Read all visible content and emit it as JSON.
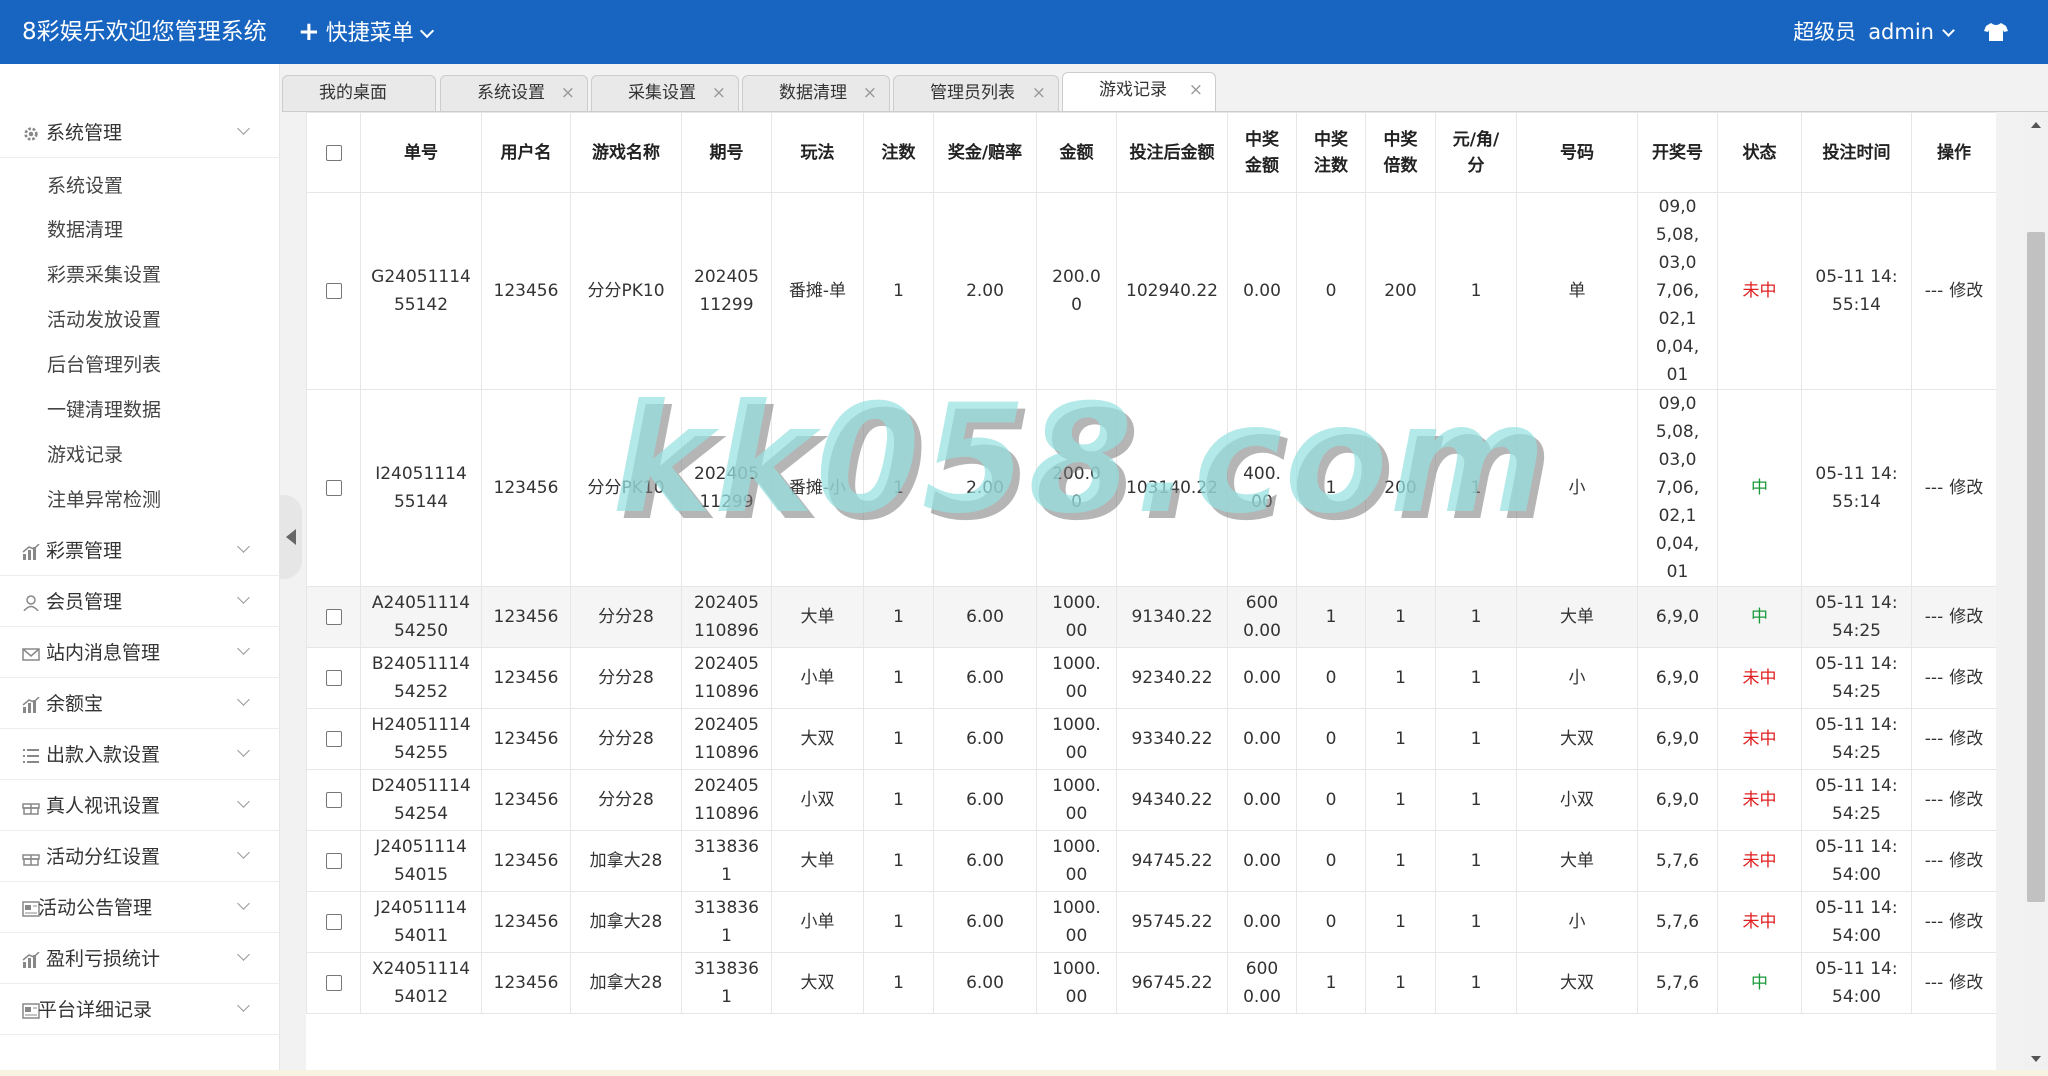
{
  "header": {
    "brand": "8彩娱乐欢迎您管理系统",
    "quick_menu": "快捷菜单",
    "role": "超级员",
    "username": "admin"
  },
  "sidebar": {
    "groups": [
      {
        "label": "系统管理",
        "icon": "gear-icon"
      },
      {
        "label": "彩票管理",
        "icon": "bar-chart-icon"
      },
      {
        "label": "会员管理",
        "icon": "user-icon"
      },
      {
        "label": "站内消息管理",
        "icon": "mail-icon"
      },
      {
        "label": "余额宝",
        "icon": "bar-chart-icon"
      },
      {
        "label": "出款入款设置",
        "icon": "list-icon"
      },
      {
        "label": "真人视讯设置",
        "icon": "gift-icon"
      },
      {
        "label": "活动分红设置",
        "icon": "gift-icon"
      },
      {
        "label": "活动公告管理",
        "icon": "doc-icon"
      },
      {
        "label": "盈利亏损统计",
        "icon": "bar-chart-icon"
      },
      {
        "label": "平台详细记录",
        "icon": "doc-icon"
      }
    ],
    "sub_items": [
      "系统设置",
      "数据清理",
      "彩票采集设置",
      "活动发放设置",
      "后台管理列表",
      "一键清理数据",
      "游戏记录",
      "注单异常检测"
    ]
  },
  "tabs": [
    {
      "label": "我的桌面"
    },
    {
      "label": "系统设置"
    },
    {
      "label": "采集设置"
    },
    {
      "label": "数据清理"
    },
    {
      "label": "管理员列表"
    },
    {
      "label": "游戏记录"
    }
  ],
  "table": {
    "headers": [
      "单号",
      "用户名",
      "游戏名称",
      "期号",
      "玩法",
      "注数",
      "奖金/赔率",
      "金额",
      "投注后金额",
      "中奖金额",
      "中奖注数",
      "中奖倍数",
      "元/角/分",
      "号码",
      "开奖号",
      "状态",
      "投注时间",
      "操作"
    ],
    "rows": [
      {
        "order_no": "G2405111455142",
        "user": "123456",
        "game": "分分PK10",
        "period": "20240511299",
        "play": "番摊-单",
        "bets": "1",
        "odds": "2.00",
        "amount": "200.00",
        "after": "102940.22",
        "win_amount": "0.00",
        "win_bets": "0",
        "multiple": "200",
        "unit": "1",
        "number": "单",
        "draw": "09,05,08,03,07,06,02,10,04,01",
        "status": "未中",
        "time": "05-11 14:55:14",
        "op_dash": "---",
        "op_edit": "修改"
      },
      {
        "order_no": "I2405111455144",
        "user": "123456",
        "game": "分分PK10",
        "period": "20240511299",
        "play": "番摊-小",
        "bets": "1",
        "odds": "2.00",
        "amount": "200.00",
        "after": "103140.22",
        "win_amount": "400.00",
        "win_bets": "1",
        "multiple": "200",
        "unit": "1",
        "number": "小",
        "draw": "09,05,08,03,07,06,02,10,04,01",
        "status": "中",
        "time": "05-11 14:55:14",
        "op_dash": "---",
        "op_edit": "修改"
      },
      {
        "order_no": "A2405111454250",
        "user": "123456",
        "game": "分分28",
        "period": "202405110896",
        "play": "大单",
        "bets": "1",
        "odds": "6.00",
        "amount": "1000.00",
        "after": "91340.22",
        "win_amount": "6000.00",
        "win_bets": "1",
        "multiple": "1",
        "unit": "1",
        "number": "大单",
        "draw": "6,9,0",
        "status": "中",
        "time": "05-11 14:54:25",
        "op_dash": "---",
        "op_edit": "修改"
      },
      {
        "order_no": "B2405111454252",
        "user": "123456",
        "game": "分分28",
        "period": "202405110896",
        "play": "小单",
        "bets": "1",
        "odds": "6.00",
        "amount": "1000.00",
        "after": "92340.22",
        "win_amount": "0.00",
        "win_bets": "0",
        "multiple": "1",
        "unit": "1",
        "number": "小",
        "draw": "6,9,0",
        "status": "未中",
        "time": "05-11 14:54:25",
        "op_dash": "---",
        "op_edit": "修改"
      },
      {
        "order_no": "H2405111454255",
        "user": "123456",
        "game": "分分28",
        "period": "202405110896",
        "play": "大双",
        "bets": "1",
        "odds": "6.00",
        "amount": "1000.00",
        "after": "93340.22",
        "win_amount": "0.00",
        "win_bets": "0",
        "multiple": "1",
        "unit": "1",
        "number": "大双",
        "draw": "6,9,0",
        "status": "未中",
        "time": "05-11 14:54:25",
        "op_dash": "---",
        "op_edit": "修改"
      },
      {
        "order_no": "D2405111454254",
        "user": "123456",
        "game": "分分28",
        "period": "202405110896",
        "play": "小双",
        "bets": "1",
        "odds": "6.00",
        "amount": "1000.00",
        "after": "94340.22",
        "win_amount": "0.00",
        "win_bets": "0",
        "multiple": "1",
        "unit": "1",
        "number": "小双",
        "draw": "6,9,0",
        "status": "未中",
        "time": "05-11 14:54:25",
        "op_dash": "---",
        "op_edit": "修改"
      },
      {
        "order_no": "J2405111454015",
        "user": "123456",
        "game": "加拿大28",
        "period": "3138361",
        "play": "大单",
        "bets": "1",
        "odds": "6.00",
        "amount": "1000.00",
        "after": "94745.22",
        "win_amount": "0.00",
        "win_bets": "0",
        "multiple": "1",
        "unit": "1",
        "number": "大单",
        "draw": "5,7,6",
        "status": "未中",
        "time": "05-11 14:54:00",
        "op_dash": "---",
        "op_edit": "修改"
      },
      {
        "order_no": "J2405111454011",
        "user": "123456",
        "game": "加拿大28",
        "period": "3138361",
        "play": "小单",
        "bets": "1",
        "odds": "6.00",
        "amount": "1000.00",
        "after": "95745.22",
        "win_amount": "0.00",
        "win_bets": "0",
        "multiple": "1",
        "unit": "1",
        "number": "小",
        "draw": "5,7,6",
        "status": "未中",
        "time": "05-11 14:54:00",
        "op_dash": "---",
        "op_edit": "修改"
      },
      {
        "order_no": "X2405111454012",
        "user": "123456",
        "game": "加拿大28",
        "period": "3138361",
        "play": "大双",
        "bets": "1",
        "odds": "6.00",
        "amount": "1000.00",
        "after": "96745.22",
        "win_amount": "6000.00",
        "win_bets": "1",
        "multiple": "1",
        "unit": "1",
        "number": "大双",
        "draw": "5,7,6",
        "status": "中",
        "time": "05-11 14:54:00",
        "op_dash": "---",
        "op_edit": "修改"
      }
    ]
  },
  "watermark": "kk058.com",
  "colors": {
    "header_bg": "#1765c1",
    "lost": "#e02020",
    "won": "#1a9a3a"
  }
}
